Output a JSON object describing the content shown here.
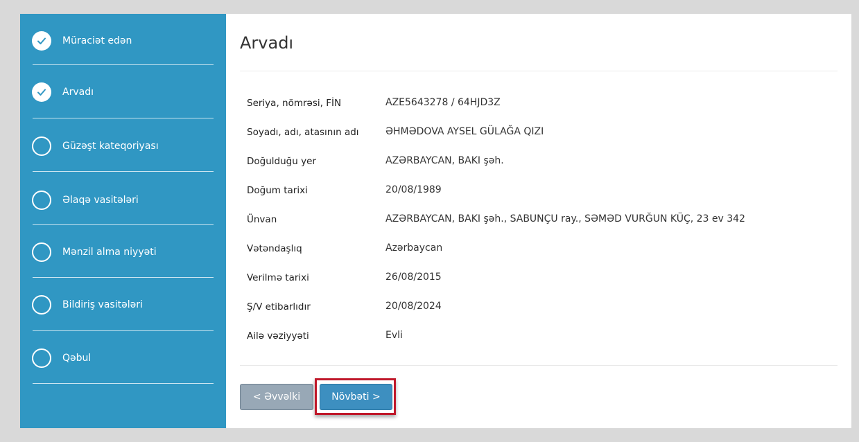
{
  "sidebar": {
    "steps": [
      {
        "label": "Müraciət edən",
        "done": true
      },
      {
        "label": "Arvadı",
        "done": true
      },
      {
        "label": "Güzəşt kateqoriyası",
        "done": false
      },
      {
        "label": "Əlaqə vasitələri",
        "done": false
      },
      {
        "label": "Mənzil alma niyyəti",
        "done": false
      },
      {
        "label": "Bildiriş vasitələri",
        "done": false
      },
      {
        "label": "Qəbul",
        "done": false
      }
    ]
  },
  "main": {
    "title": "Arvadı",
    "fields": [
      {
        "label": "Seriya, nömrəsi, FİN",
        "value": "AZE5643278 / 64HJD3Z"
      },
      {
        "label": "Soyadı, adı, atasının adı",
        "value": "ƏHMƏDOVA AYSEL GÜLAĞA QIZI"
      },
      {
        "label": "Doğulduğu yer",
        "value": "AZƏRBAYCAN, BAKI şəh."
      },
      {
        "label": "Doğum tarixi",
        "value": "20/08/1989"
      },
      {
        "label": "Ünvan",
        "value": "AZƏRBAYCAN, BAKI şəh., SABUNÇU ray., SƏMƏD VURĞUN KÜÇ, 23 ev 342"
      },
      {
        "label": "Vətəndaşlıq",
        "value": "Azərbaycan"
      },
      {
        "label": "Verilmə tarixi",
        "value": "26/08/2015"
      },
      {
        "label": "Ş/V etibarlıdır",
        "value": "20/08/2024"
      },
      {
        "label": "Ailə vəziyyəti",
        "value": "Evli"
      }
    ],
    "buttons": {
      "prev": "< Əvvəlki",
      "next": "Növbəti >"
    }
  },
  "colors": {
    "sidebar": "#3097c3",
    "next_button": "#3d8fc0",
    "prev_button": "#98a8b6",
    "highlight": "#c0182a"
  }
}
